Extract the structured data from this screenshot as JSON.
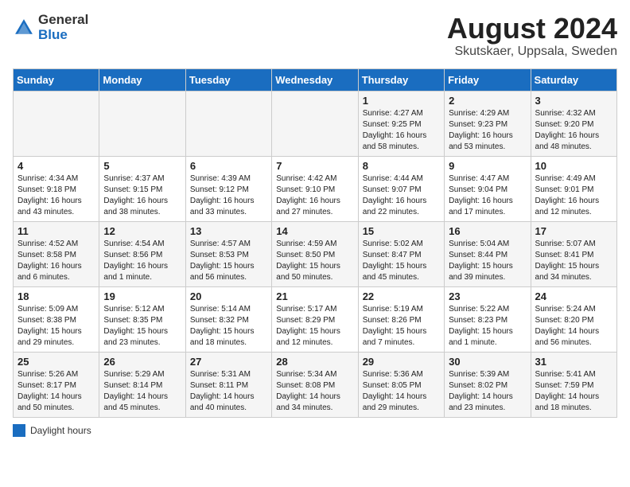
{
  "header": {
    "logo_general": "General",
    "logo_blue": "Blue",
    "month_year": "August 2024",
    "location": "Skutskaer, Uppsala, Sweden"
  },
  "days_of_week": [
    "Sunday",
    "Monday",
    "Tuesday",
    "Wednesday",
    "Thursday",
    "Friday",
    "Saturday"
  ],
  "legend": {
    "label": "Daylight hours"
  },
  "weeks": [
    {
      "days": [
        {
          "number": "",
          "info": ""
        },
        {
          "number": "",
          "info": ""
        },
        {
          "number": "",
          "info": ""
        },
        {
          "number": "",
          "info": ""
        },
        {
          "number": "1",
          "info": "Sunrise: 4:27 AM\nSunset: 9:25 PM\nDaylight: 16 hours\nand 58 minutes."
        },
        {
          "number": "2",
          "info": "Sunrise: 4:29 AM\nSunset: 9:23 PM\nDaylight: 16 hours\nand 53 minutes."
        },
        {
          "number": "3",
          "info": "Sunrise: 4:32 AM\nSunset: 9:20 PM\nDaylight: 16 hours\nand 48 minutes."
        }
      ]
    },
    {
      "days": [
        {
          "number": "4",
          "info": "Sunrise: 4:34 AM\nSunset: 9:18 PM\nDaylight: 16 hours\nand 43 minutes."
        },
        {
          "number": "5",
          "info": "Sunrise: 4:37 AM\nSunset: 9:15 PM\nDaylight: 16 hours\nand 38 minutes."
        },
        {
          "number": "6",
          "info": "Sunrise: 4:39 AM\nSunset: 9:12 PM\nDaylight: 16 hours\nand 33 minutes."
        },
        {
          "number": "7",
          "info": "Sunrise: 4:42 AM\nSunset: 9:10 PM\nDaylight: 16 hours\nand 27 minutes."
        },
        {
          "number": "8",
          "info": "Sunrise: 4:44 AM\nSunset: 9:07 PM\nDaylight: 16 hours\nand 22 minutes."
        },
        {
          "number": "9",
          "info": "Sunrise: 4:47 AM\nSunset: 9:04 PM\nDaylight: 16 hours\nand 17 minutes."
        },
        {
          "number": "10",
          "info": "Sunrise: 4:49 AM\nSunset: 9:01 PM\nDaylight: 16 hours\nand 12 minutes."
        }
      ]
    },
    {
      "days": [
        {
          "number": "11",
          "info": "Sunrise: 4:52 AM\nSunset: 8:58 PM\nDaylight: 16 hours\nand 6 minutes."
        },
        {
          "number": "12",
          "info": "Sunrise: 4:54 AM\nSunset: 8:56 PM\nDaylight: 16 hours\nand 1 minute."
        },
        {
          "number": "13",
          "info": "Sunrise: 4:57 AM\nSunset: 8:53 PM\nDaylight: 15 hours\nand 56 minutes."
        },
        {
          "number": "14",
          "info": "Sunrise: 4:59 AM\nSunset: 8:50 PM\nDaylight: 15 hours\nand 50 minutes."
        },
        {
          "number": "15",
          "info": "Sunrise: 5:02 AM\nSunset: 8:47 PM\nDaylight: 15 hours\nand 45 minutes."
        },
        {
          "number": "16",
          "info": "Sunrise: 5:04 AM\nSunset: 8:44 PM\nDaylight: 15 hours\nand 39 minutes."
        },
        {
          "number": "17",
          "info": "Sunrise: 5:07 AM\nSunset: 8:41 PM\nDaylight: 15 hours\nand 34 minutes."
        }
      ]
    },
    {
      "days": [
        {
          "number": "18",
          "info": "Sunrise: 5:09 AM\nSunset: 8:38 PM\nDaylight: 15 hours\nand 29 minutes."
        },
        {
          "number": "19",
          "info": "Sunrise: 5:12 AM\nSunset: 8:35 PM\nDaylight: 15 hours\nand 23 minutes."
        },
        {
          "number": "20",
          "info": "Sunrise: 5:14 AM\nSunset: 8:32 PM\nDaylight: 15 hours\nand 18 minutes."
        },
        {
          "number": "21",
          "info": "Sunrise: 5:17 AM\nSunset: 8:29 PM\nDaylight: 15 hours\nand 12 minutes."
        },
        {
          "number": "22",
          "info": "Sunrise: 5:19 AM\nSunset: 8:26 PM\nDaylight: 15 hours\nand 7 minutes."
        },
        {
          "number": "23",
          "info": "Sunrise: 5:22 AM\nSunset: 8:23 PM\nDaylight: 15 hours\nand 1 minute."
        },
        {
          "number": "24",
          "info": "Sunrise: 5:24 AM\nSunset: 8:20 PM\nDaylight: 14 hours\nand 56 minutes."
        }
      ]
    },
    {
      "days": [
        {
          "number": "25",
          "info": "Sunrise: 5:26 AM\nSunset: 8:17 PM\nDaylight: 14 hours\nand 50 minutes."
        },
        {
          "number": "26",
          "info": "Sunrise: 5:29 AM\nSunset: 8:14 PM\nDaylight: 14 hours\nand 45 minutes."
        },
        {
          "number": "27",
          "info": "Sunrise: 5:31 AM\nSunset: 8:11 PM\nDaylight: 14 hours\nand 40 minutes."
        },
        {
          "number": "28",
          "info": "Sunrise: 5:34 AM\nSunset: 8:08 PM\nDaylight: 14 hours\nand 34 minutes."
        },
        {
          "number": "29",
          "info": "Sunrise: 5:36 AM\nSunset: 8:05 PM\nDaylight: 14 hours\nand 29 minutes."
        },
        {
          "number": "30",
          "info": "Sunrise: 5:39 AM\nSunset: 8:02 PM\nDaylight: 14 hours\nand 23 minutes."
        },
        {
          "number": "31",
          "info": "Sunrise: 5:41 AM\nSunset: 7:59 PM\nDaylight: 14 hours\nand 18 minutes."
        }
      ]
    }
  ]
}
